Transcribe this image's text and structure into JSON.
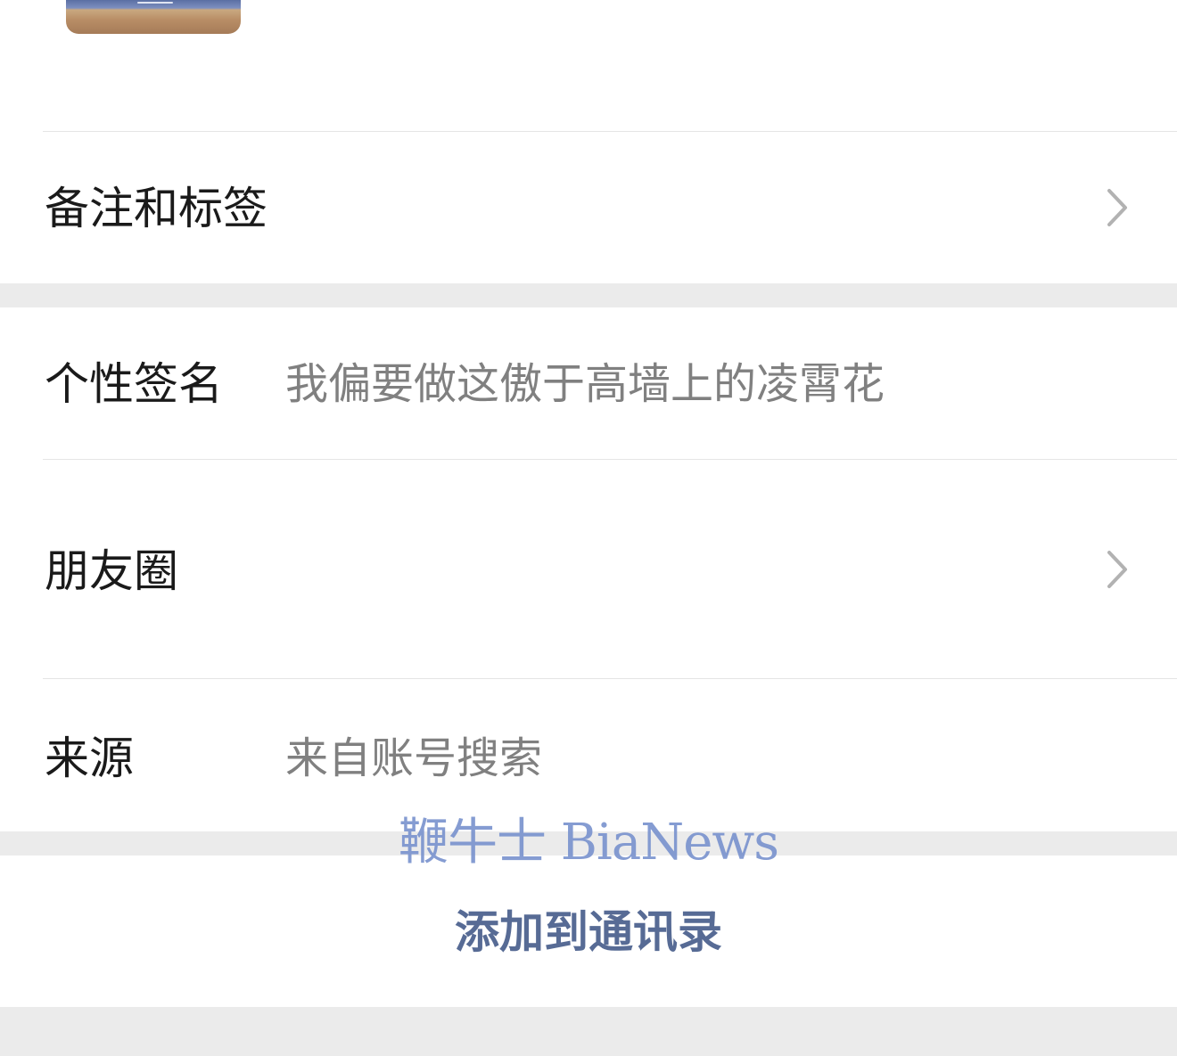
{
  "rows": {
    "remark_tags": {
      "label": "备注和标签"
    },
    "signature": {
      "label": "个性签名",
      "value": "我偏要做这傲于高墙上的凌霄花"
    },
    "moments": {
      "label": "朋友圈"
    },
    "source": {
      "label": "来源",
      "value": "来自账号搜索"
    }
  },
  "watermark": "鞭牛士 BiaNews",
  "actions": {
    "add_to_contacts": "添加到通讯录"
  },
  "icons": {
    "chevron": "chevron-right-icon"
  },
  "colors": {
    "link": "#576b95",
    "label_text": "#1a1a1a",
    "value_text": "#808080",
    "background": "#ebebeb",
    "watermark": "#7891cd"
  }
}
